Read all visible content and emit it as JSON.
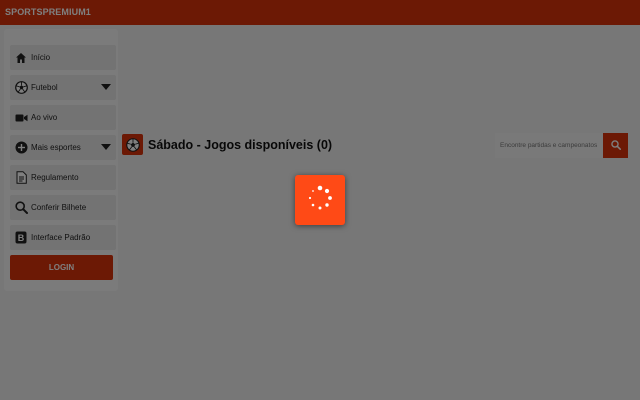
{
  "header": {
    "brand": "SPORTSPREMIUM1"
  },
  "sidebar": {
    "items": [
      {
        "label": "Início",
        "icon": "home-icon"
      },
      {
        "label": "Futebol",
        "icon": "soccer-ball-icon",
        "has_dropdown": true
      },
      {
        "label": "Ao vivo",
        "icon": "video-camera-icon"
      },
      {
        "label": "Mais esportes",
        "icon": "plus-circle-icon",
        "has_dropdown": true
      },
      {
        "label": "Regulamento",
        "icon": "document-icon"
      },
      {
        "label": "Conferir Bilhete",
        "icon": "search-icon"
      },
      {
        "label": "Interface Padrão",
        "icon": "letter-b-icon"
      }
    ],
    "login_label": "LOGIN"
  },
  "main": {
    "title": "Sábado - Jogos disponíveis (0)",
    "title_icon": "soccer-ball-icon"
  },
  "search": {
    "placeholder": "Encontre partidas e campeonatos",
    "button_icon": "search-icon"
  },
  "loader": {
    "icon": "spinner-icon"
  },
  "colors": {
    "brand": "#d8330a",
    "loader": "#ff4a16",
    "overlay": "rgba(0,0,0,0.5)"
  }
}
